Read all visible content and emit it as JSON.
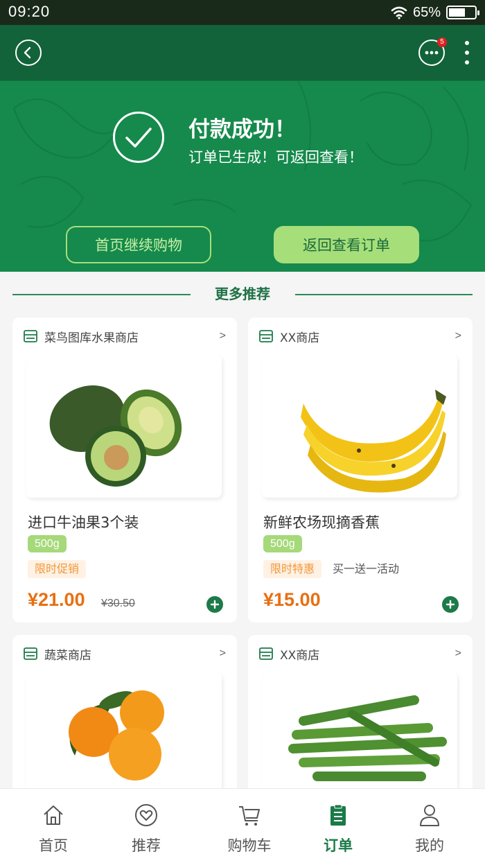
{
  "status_bar": {
    "time": "09:20",
    "battery": "65%",
    "battery_level": 0.65
  },
  "nav": {
    "badge_count": "5"
  },
  "hero": {
    "title": "付款成功！",
    "subtitle": "订单已生成！可返回查看！",
    "continue_label": "首页继续购物",
    "view_order_label": "返回查看订单"
  },
  "section": {
    "title": "更多推荐"
  },
  "products": [
    {
      "shop": "菜鸟图库水果商店",
      "arrow": ">",
      "name": "进口牛油果3个装",
      "weight": "500g",
      "promo": "限时促销",
      "promo_extra": "",
      "price": "¥21.00",
      "old_price": "¥30.50",
      "image": "avocado"
    },
    {
      "shop": "XX商店",
      "arrow": ">",
      "name": "新鲜农场现摘香蕉",
      "weight": "500g",
      "promo": "限时特惠",
      "promo_extra": "买一送一活动",
      "price": "¥15.00",
      "old_price": "",
      "image": "banana"
    },
    {
      "shop": "蔬菜商店",
      "arrow": ">",
      "image": "orange"
    },
    {
      "shop": "XX商店",
      "arrow": ">",
      "image": "okra"
    }
  ],
  "tabbar": {
    "items": [
      {
        "label": "首页",
        "icon": "home-icon"
      },
      {
        "label": "推荐",
        "icon": "heart-icon"
      },
      {
        "label": "购物车",
        "icon": "cart-icon"
      },
      {
        "label": "订单",
        "icon": "order-icon",
        "active": true
      },
      {
        "label": "我的",
        "icon": "user-icon"
      }
    ]
  },
  "colors": {
    "brand_green": "#158a4c",
    "accent_light": "#a6de7a",
    "price_orange": "#e86f12"
  }
}
